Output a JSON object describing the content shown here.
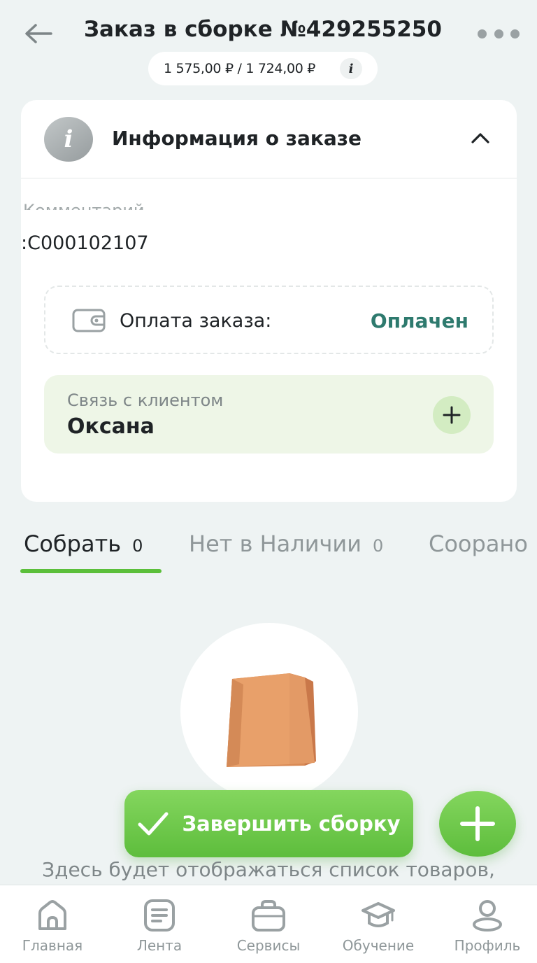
{
  "header": {
    "title": "Заказ в сборке №429255250",
    "price": "1 575,00 ₽ / 1 724,00 ₽",
    "info_glyph": "i",
    "back_icon": "arrow-left-icon",
    "more_icon": "more-horizontal-icon"
  },
  "order_info": {
    "icon_glyph": "i",
    "title": "Информация о заказе",
    "comment_label": "Комментарий",
    "comment_value": ":С000102107",
    "payment": {
      "label": "Оплата заказа:",
      "status": "Оплачен",
      "status_color": "#2e7a6e"
    },
    "contact": {
      "label": "Связь с клиентом",
      "name": "Оксана"
    }
  },
  "tabs": [
    {
      "label": "Собрать",
      "count": "0",
      "active": true
    },
    {
      "label": "Нет в Наличии",
      "count": "0",
      "active": false
    },
    {
      "label": "Соорано",
      "count": "",
      "active": false
    }
  ],
  "actions": {
    "finish_label": "Завершить сборку",
    "accent_color": "#5dbd3c"
  },
  "empty_state": {
    "text": "Здесь будет отображаться список товаров,"
  },
  "bottom_nav": [
    {
      "label": "Главная",
      "icon": "home-icon"
    },
    {
      "label": "Лента",
      "icon": "feed-icon"
    },
    {
      "label": "Сервисы",
      "icon": "briefcase-icon"
    },
    {
      "label": "Обучение",
      "icon": "graduation-cap-icon"
    },
    {
      "label": "Профиль",
      "icon": "profile-icon"
    }
  ]
}
